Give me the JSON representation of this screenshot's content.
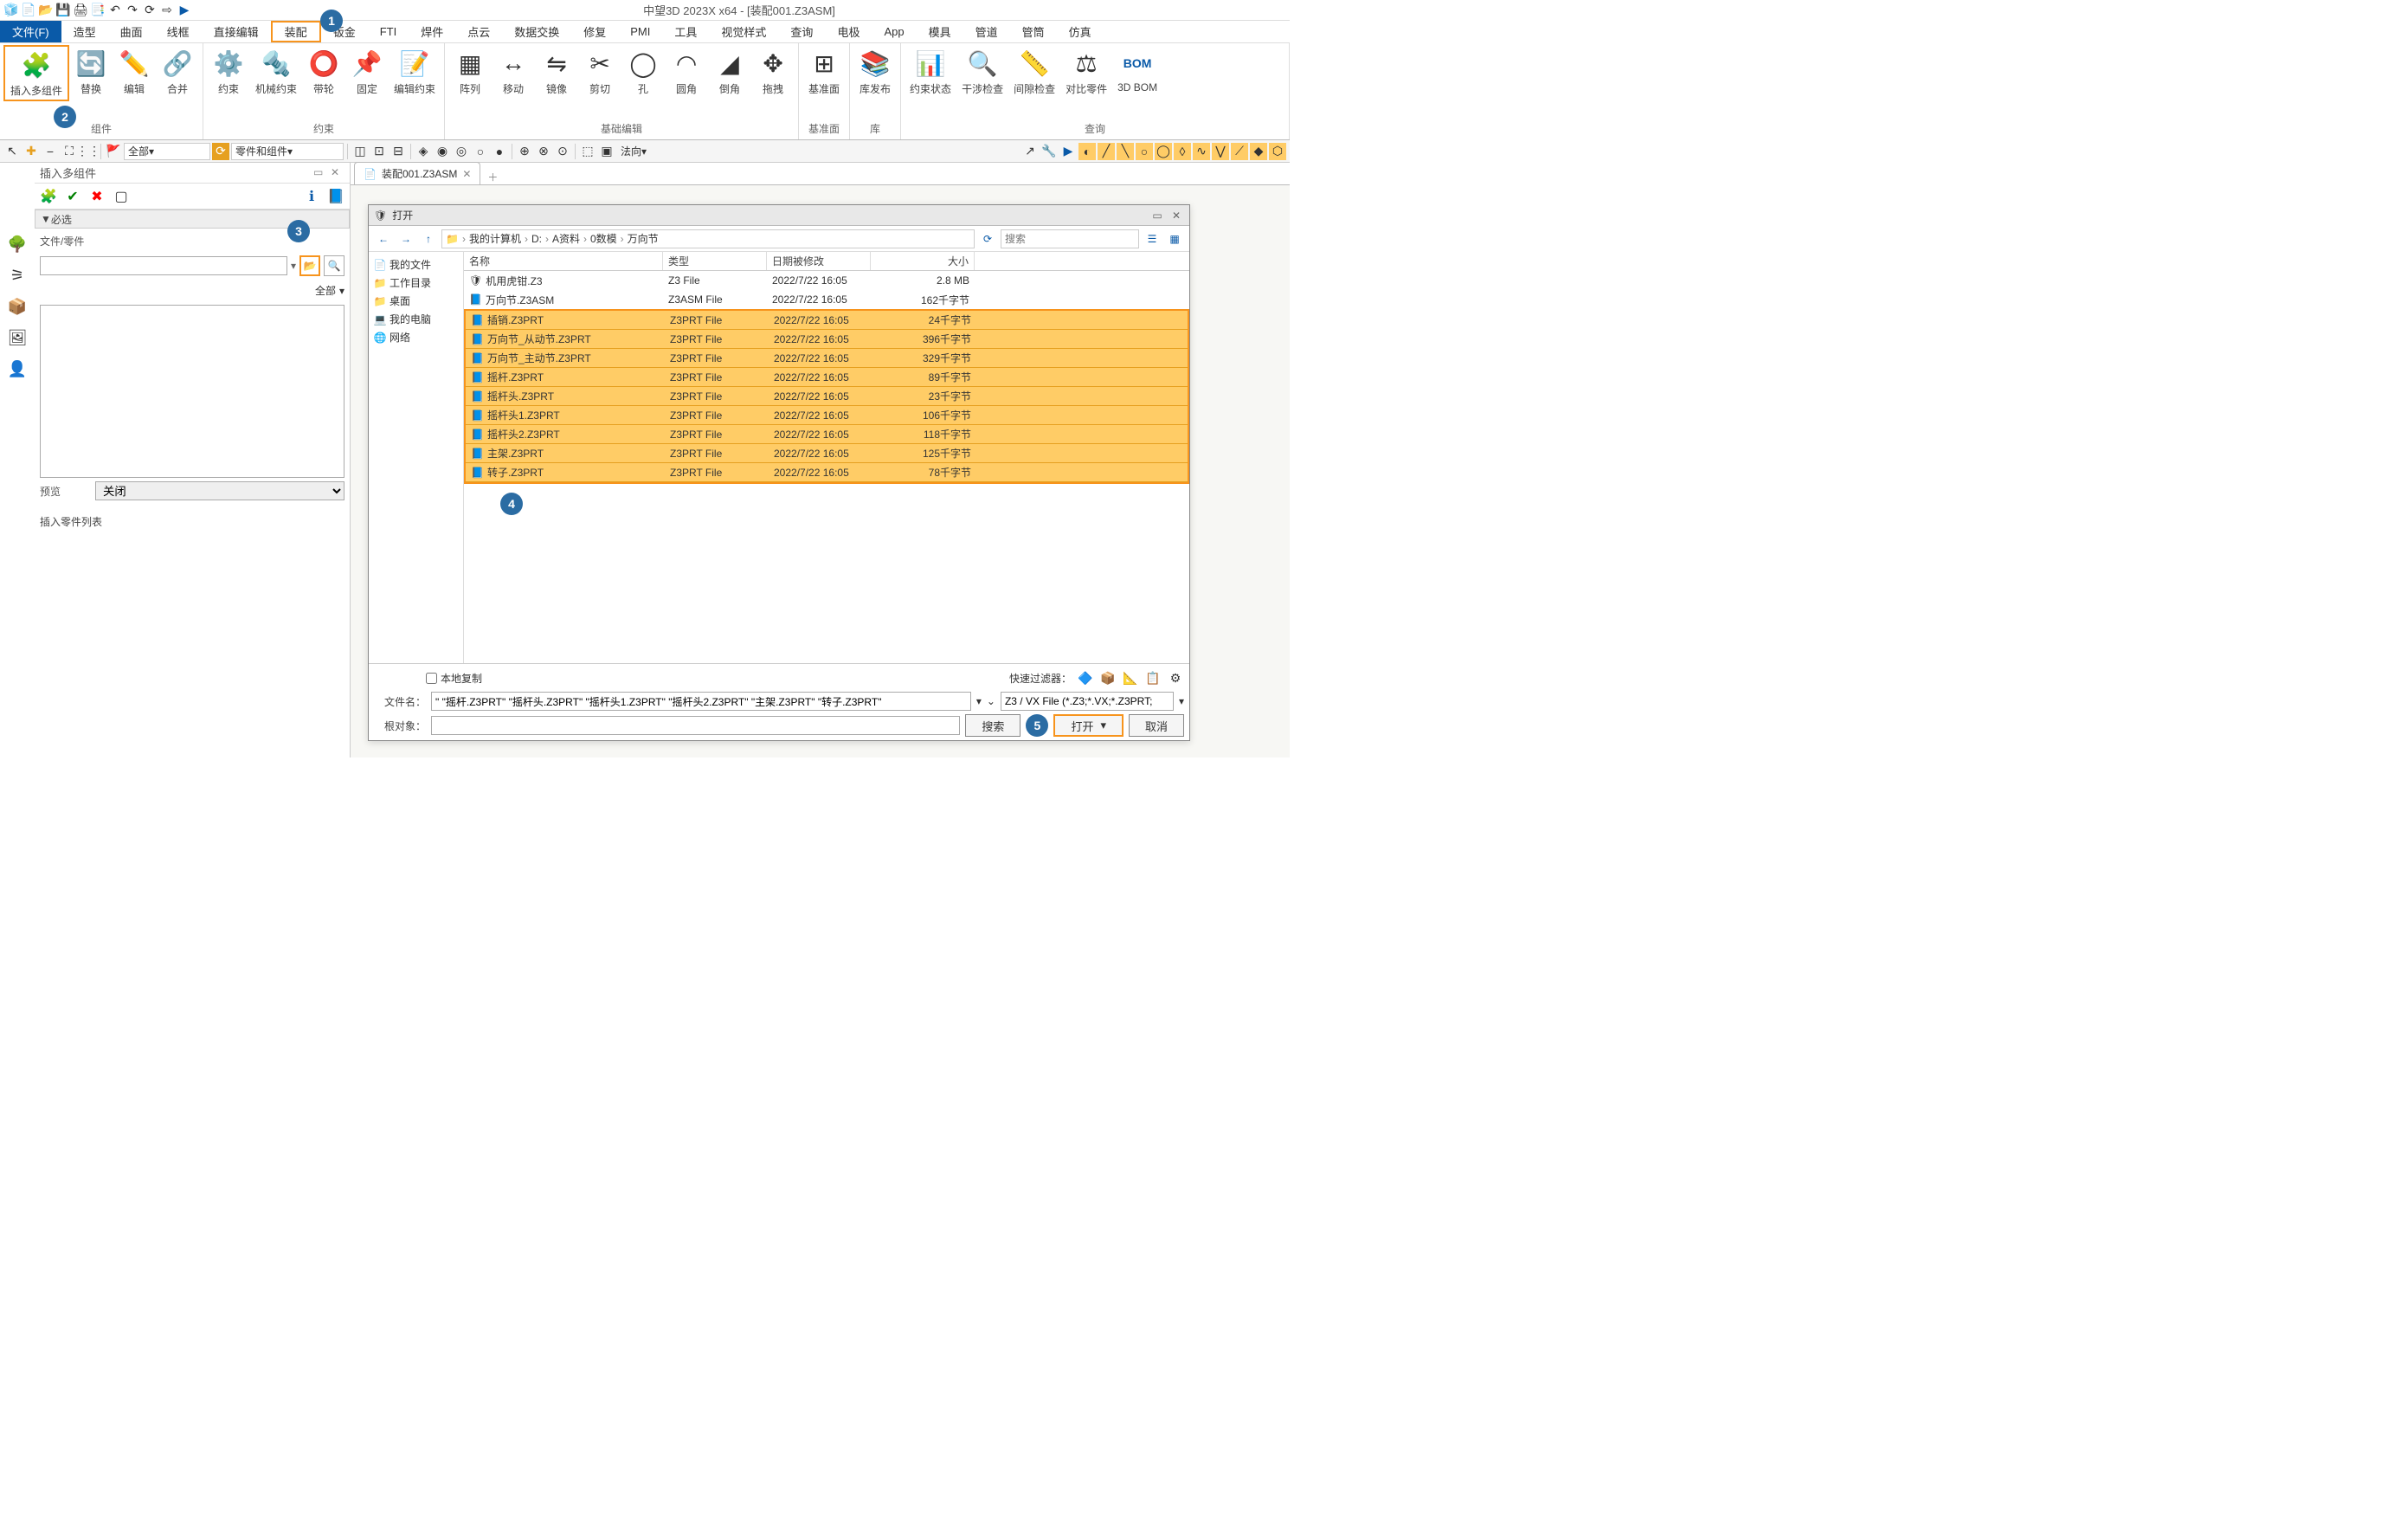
{
  "app_title": "中望3D 2023X x64 - [装配001.Z3ASM]",
  "qat_icons": [
    "app-icon",
    "new-icon",
    "open-icon",
    "save-icon",
    "print-icon",
    "print-preview-icon",
    "undo-icon",
    "redo-icon",
    "refresh-icon",
    "options-icon",
    "play-icon"
  ],
  "menu_tabs": [
    "文件(F)",
    "造型",
    "曲面",
    "线框",
    "直接编辑",
    "装配",
    "钣金",
    "FTI",
    "焊件",
    "点云",
    "数据交换",
    "修复",
    "PMI",
    "工具",
    "视觉样式",
    "查询",
    "电极",
    "App",
    "模具",
    "管道",
    "管筒",
    "仿真"
  ],
  "menu_active_index": 0,
  "menu_highlight_index": 5,
  "callouts": {
    "1": "1",
    "2": "2",
    "3": "3",
    "4": "4",
    "5": "5"
  },
  "ribbon": {
    "groups": [
      {
        "label": "组件",
        "items": [
          {
            "name": "insert-multi",
            "text": "插入多组件",
            "highlight": true
          },
          {
            "name": "replace",
            "text": "替换"
          },
          {
            "name": "edit",
            "text": "编辑"
          },
          {
            "name": "merge",
            "text": "合并"
          }
        ]
      },
      {
        "label": "约束",
        "items": [
          {
            "name": "constraint",
            "text": "约束"
          },
          {
            "name": "mech-constraint",
            "text": "机械约束"
          },
          {
            "name": "belt",
            "text": "带轮"
          },
          {
            "name": "fix",
            "text": "固定"
          },
          {
            "name": "edit-constraint",
            "text": "编辑约束"
          }
        ]
      },
      {
        "label": "基础编辑",
        "items": [
          {
            "name": "array",
            "text": "阵列"
          },
          {
            "name": "move",
            "text": "移动"
          },
          {
            "name": "mirror",
            "text": "镜像"
          },
          {
            "name": "cut",
            "text": "剪切"
          },
          {
            "name": "hole",
            "text": "孔"
          },
          {
            "name": "fillet",
            "text": "圆角"
          },
          {
            "name": "chamfer",
            "text": "倒角"
          },
          {
            "name": "drag",
            "text": "拖拽"
          }
        ]
      },
      {
        "label": "基准面",
        "items": [
          {
            "name": "datum",
            "text": "基准面"
          }
        ]
      },
      {
        "label": "库",
        "items": [
          {
            "name": "lib",
            "text": "库发布"
          }
        ]
      },
      {
        "label": "查询",
        "items": [
          {
            "name": "constraint-status",
            "text": "约束状态"
          },
          {
            "name": "interference",
            "text": "干涉检查"
          },
          {
            "name": "clearance",
            "text": "间隙检查"
          },
          {
            "name": "compare",
            "text": "对比零件"
          },
          {
            "name": "bom",
            "text": "3D BOM"
          }
        ]
      }
    ]
  },
  "toolbar2": {
    "filter_combo": "全部",
    "part_combo": "零件和组件",
    "direction": "法向"
  },
  "left_panel": {
    "title": "插入多组件",
    "section": "必选",
    "file_label": "文件/零件",
    "all_label": "全部",
    "preview_label": "预览",
    "preview_value": "关闭",
    "list_title": "插入零件列表"
  },
  "doc_tab": "装配001.Z3ASM",
  "dialog": {
    "title": "打开",
    "nav_icons": [
      "back-icon",
      "forward-icon",
      "up-icon"
    ],
    "breadcrumb": [
      "我的计算机",
      "D:",
      "A资料",
      "0数模",
      "万向节"
    ],
    "search_placeholder": "搜索",
    "tree": [
      {
        "icon": "📄",
        "label": "我的文件"
      },
      {
        "icon": "📁",
        "label": "工作目录"
      },
      {
        "icon": "📁",
        "label": "桌面"
      },
      {
        "icon": "💻",
        "label": "我的电脑"
      },
      {
        "icon": "🌐",
        "label": "网络"
      }
    ],
    "columns": [
      "名称",
      "类型",
      "日期被修改",
      "大小"
    ],
    "rows_unsel": [
      {
        "name": "机用虎钳.Z3",
        "type": "Z3 File",
        "date": "2022/7/22 16:05",
        "size": "2.8 MB"
      },
      {
        "name": "万向节.Z3ASM",
        "type": "Z3ASM File",
        "date": "2022/7/22 16:05",
        "size": "162千字节"
      }
    ],
    "rows_sel": [
      {
        "name": "插销.Z3PRT",
        "type": "Z3PRT File",
        "date": "2022/7/22 16:05",
        "size": "24千字节"
      },
      {
        "name": "万向节_从动节.Z3PRT",
        "type": "Z3PRT File",
        "date": "2022/7/22 16:05",
        "size": "396千字节"
      },
      {
        "name": "万向节_主动节.Z3PRT",
        "type": "Z3PRT File",
        "date": "2022/7/22 16:05",
        "size": "329千字节"
      },
      {
        "name": "摇杆.Z3PRT",
        "type": "Z3PRT File",
        "date": "2022/7/22 16:05",
        "size": "89千字节"
      },
      {
        "name": "摇杆头.Z3PRT",
        "type": "Z3PRT File",
        "date": "2022/7/22 16:05",
        "size": "23千字节"
      },
      {
        "name": "摇杆头1.Z3PRT",
        "type": "Z3PRT File",
        "date": "2022/7/22 16:05",
        "size": "106千字节"
      },
      {
        "name": "摇杆头2.Z3PRT",
        "type": "Z3PRT File",
        "date": "2022/7/22 16:05",
        "size": "118千字节"
      },
      {
        "name": "主架.Z3PRT",
        "type": "Z3PRT File",
        "date": "2022/7/22 16:05",
        "size": "125千字节"
      },
      {
        "name": "转子.Z3PRT",
        "type": "Z3PRT File",
        "date": "2022/7/22 16:05",
        "size": "78千字节"
      }
    ],
    "local_copy": "本地复制",
    "quick_filter_label": "快速过滤器：",
    "filename_label": "文件名：",
    "filename_value": "\" \"摇杆.Z3PRT\" \"摇杆头.Z3PRT\" \"摇杆头1.Z3PRT\" \"摇杆头2.Z3PRT\" \"主架.Z3PRT\" \"转子.Z3PRT\"",
    "filetype": "Z3 / VX File (*.Z3;*.VX;*.Z3PRT;",
    "root_label": "根对象：",
    "btn_search": "搜索",
    "btn_open": "打开",
    "btn_cancel": "取消"
  }
}
